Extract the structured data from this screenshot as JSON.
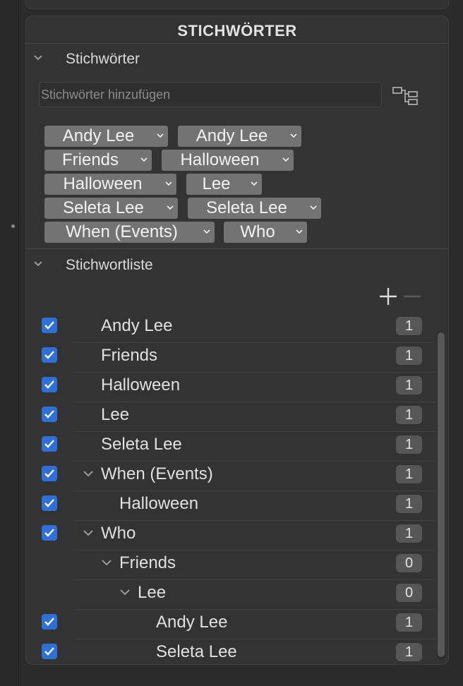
{
  "panel": {
    "title": "STICHWÖRTER"
  },
  "keywords_section": {
    "label": "Stichwörter",
    "input_placeholder": "Stichwörter hinzufügen",
    "tags": [
      "Andy Lee",
      "Andy Lee",
      "Friends",
      "Halloween",
      "Halloween",
      "Lee",
      "Seleta Lee",
      "Seleta Lee",
      "When (Events)",
      "Who"
    ]
  },
  "list_section": {
    "label": "Stichwortliste",
    "rows": [
      {
        "label": "Andy Lee",
        "count": "1",
        "checked": true,
        "expanded": false
      },
      {
        "label": "Friends",
        "count": "1",
        "checked": true,
        "expanded": false
      },
      {
        "label": "Halloween",
        "count": "1",
        "checked": true,
        "expanded": false
      },
      {
        "label": "Lee",
        "count": "1",
        "checked": true,
        "expanded": false
      },
      {
        "label": "Seleta Lee",
        "count": "1",
        "checked": true,
        "expanded": false
      },
      {
        "label": "When (Events)",
        "count": "1",
        "checked": true,
        "expanded": true
      },
      {
        "label": "Halloween",
        "count": "1",
        "checked": true,
        "expanded": false
      },
      {
        "label": "Who",
        "count": "1",
        "checked": true,
        "expanded": true
      },
      {
        "label": "Friends",
        "count": "0",
        "checked": false,
        "expanded": true
      },
      {
        "label": "Lee",
        "count": "0",
        "checked": false,
        "expanded": true
      },
      {
        "label": "Andy Lee",
        "count": "1",
        "checked": true,
        "expanded": false
      },
      {
        "label": "Seleta Lee",
        "count": "1",
        "checked": true,
        "expanded": false
      }
    ]
  },
  "colors": {
    "background": "#2b2b2b",
    "panel": "#333333",
    "checkbox": "#2f6fd8",
    "tag": "#737373",
    "count_badge": "#575757"
  },
  "icons": {
    "section_toggle": "chevron-down-icon",
    "hierarchy": "hierarchy-icon",
    "add": "plus-icon",
    "remove": "minus-icon",
    "check": "checkmark-icon"
  }
}
